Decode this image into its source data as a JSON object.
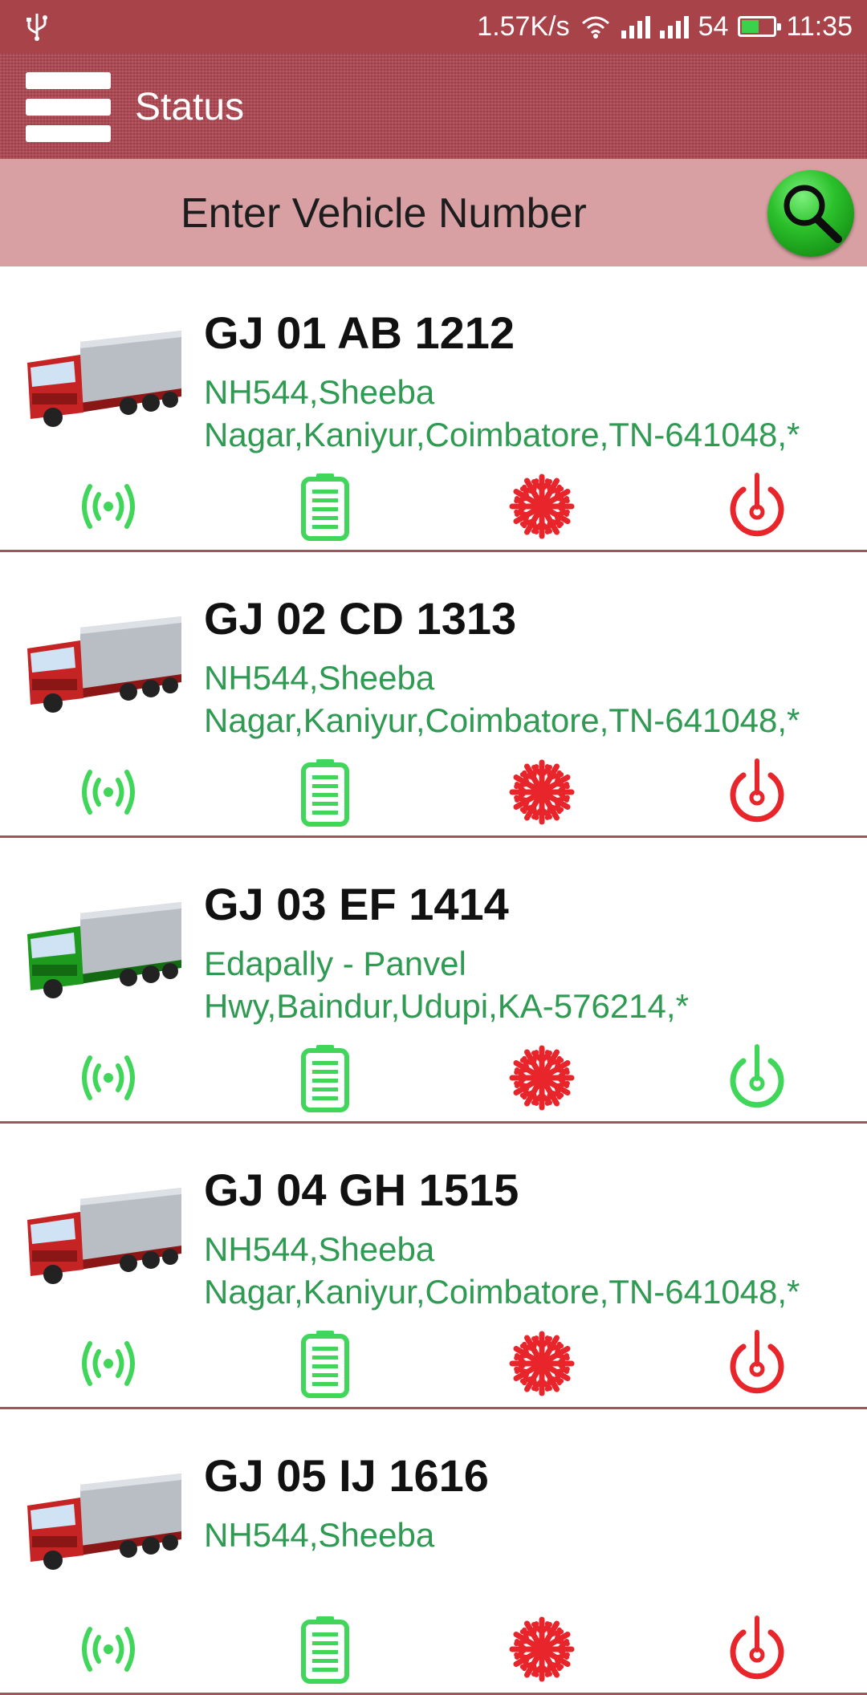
{
  "status_bar": {
    "net_speed": "1.57K/s",
    "battery_level": "54",
    "time": "11:35"
  },
  "header": {
    "title": "Status"
  },
  "search": {
    "placeholder": "Enter Vehicle Number"
  },
  "colors": {
    "header": "#ad4650",
    "search_bar": "#d8a0a3",
    "address": "#2e9a52",
    "ok_green": "#3fd65a",
    "alert_red": "#e8252b",
    "divider": "#a8525b"
  },
  "vehicles": [
    {
      "number": "GJ 01 AB 1212",
      "address_line1": "NH544,Sheeba",
      "address_line2": "Nagar,Kaniyur,Coimbatore,TN-641048,*",
      "truck_color": "red",
      "status": {
        "signal": "green",
        "battery": "green",
        "ac": "red",
        "ignition": "red"
      }
    },
    {
      "number": "GJ 02 CD 1313",
      "address_line1": "NH544,Sheeba",
      "address_line2": "Nagar,Kaniyur,Coimbatore,TN-641048,*",
      "truck_color": "red",
      "status": {
        "signal": "green",
        "battery": "green",
        "ac": "red",
        "ignition": "red"
      }
    },
    {
      "number": "GJ 03 EF 1414",
      "address_line1": "Edapally - Panvel",
      "address_line2": "Hwy,Baindur,Udupi,KA-576214,*",
      "truck_color": "green",
      "status": {
        "signal": "green",
        "battery": "green",
        "ac": "red",
        "ignition": "green"
      }
    },
    {
      "number": "GJ 04 GH 1515",
      "address_line1": "NH544,Sheeba",
      "address_line2": "Nagar,Kaniyur,Coimbatore,TN-641048,*",
      "truck_color": "red",
      "status": {
        "signal": "green",
        "battery": "green",
        "ac": "red",
        "ignition": "red"
      }
    },
    {
      "number": "GJ 05 IJ 1616",
      "address_line1": "NH544,Sheeba",
      "address_line2": "",
      "truck_color": "red",
      "status": {
        "signal": "green",
        "battery": "green",
        "ac": "red",
        "ignition": "red"
      }
    }
  ]
}
